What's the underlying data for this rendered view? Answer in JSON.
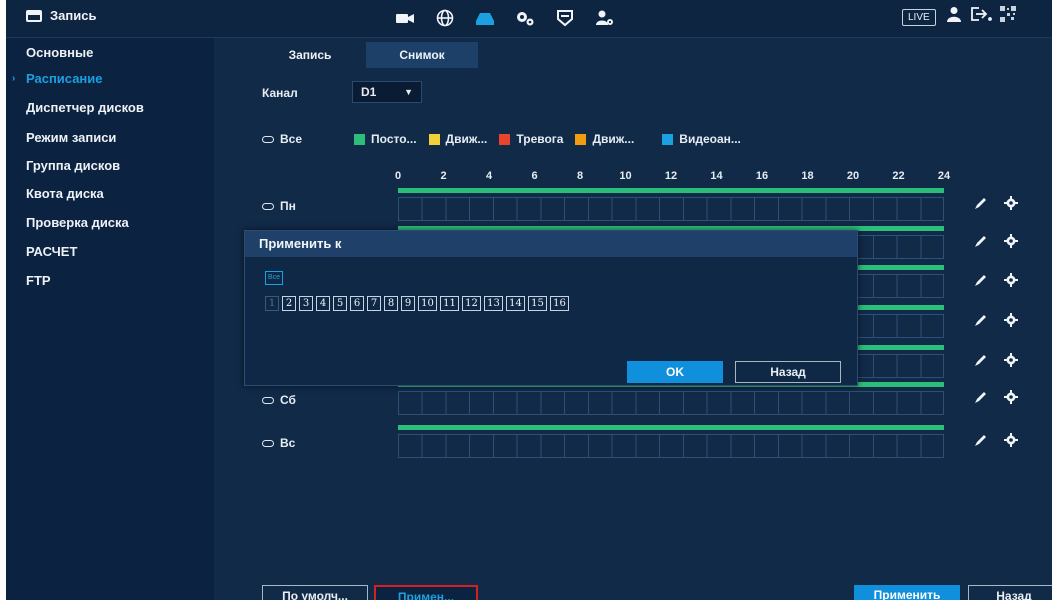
{
  "header": {
    "title": "Запись",
    "live_label": "LIVE",
    "icons": [
      "camera-icon",
      "network-icon",
      "storage-icon",
      "system-settings-icon",
      "security-icon",
      "account-icon"
    ]
  },
  "sidebar": {
    "items": [
      {
        "label": "Основные",
        "selected": false
      },
      {
        "label": "Расписание",
        "selected": true
      },
      {
        "label": "Диспетчер дисков",
        "selected": false
      },
      {
        "label": "Режим записи",
        "selected": false
      },
      {
        "label": "Группа дисков",
        "selected": false
      },
      {
        "label": "Квота диска",
        "selected": false
      },
      {
        "label": "Проверка диска",
        "selected": false
      },
      {
        "label": "РАСЧЕТ",
        "selected": false
      },
      {
        "label": "FTP",
        "selected": false
      }
    ]
  },
  "tabs": [
    {
      "label": "Запись",
      "active": false
    },
    {
      "label": "Снимок",
      "active": true
    }
  ],
  "channel": {
    "label": "Канал",
    "value": "D1"
  },
  "legend": {
    "all_label": "Все",
    "items": [
      {
        "label": "Посто...",
        "color": "#2dbd7a"
      },
      {
        "label": "Движ...",
        "color": "#f2d03a"
      },
      {
        "label": "Тревога",
        "color": "#e8452c"
      },
      {
        "label": "Движ...",
        "color": "#f39c12"
      },
      {
        "label": "Видеоан...",
        "color": "#1ba1e2"
      }
    ]
  },
  "timeline": {
    "ticks": [
      "0",
      "2",
      "4",
      "6",
      "8",
      "10",
      "12",
      "14",
      "16",
      "18",
      "20",
      "22",
      "24"
    ],
    "days": [
      {
        "label": "Пн",
        "schedule": [
          [
            0,
            24
          ]
        ]
      },
      {
        "label": "Сб",
        "schedule": [
          [
            0,
            24
          ]
        ]
      },
      {
        "label": "Вс",
        "schedule": [
          [
            0,
            24
          ]
        ]
      }
    ]
  },
  "dialog": {
    "title": "Применить к",
    "all_label": "Все",
    "channels": [
      "1",
      "2",
      "3",
      "4",
      "5",
      "6",
      "7",
      "8",
      "9",
      "10",
      "11",
      "12",
      "13",
      "14",
      "15",
      "16"
    ],
    "ok_label": "OK",
    "back_label": "Назад"
  },
  "footer": {
    "default_label": "По умолч...",
    "copy_label": "Примен...",
    "apply_label": "Применить",
    "back_label": "Назад"
  }
}
